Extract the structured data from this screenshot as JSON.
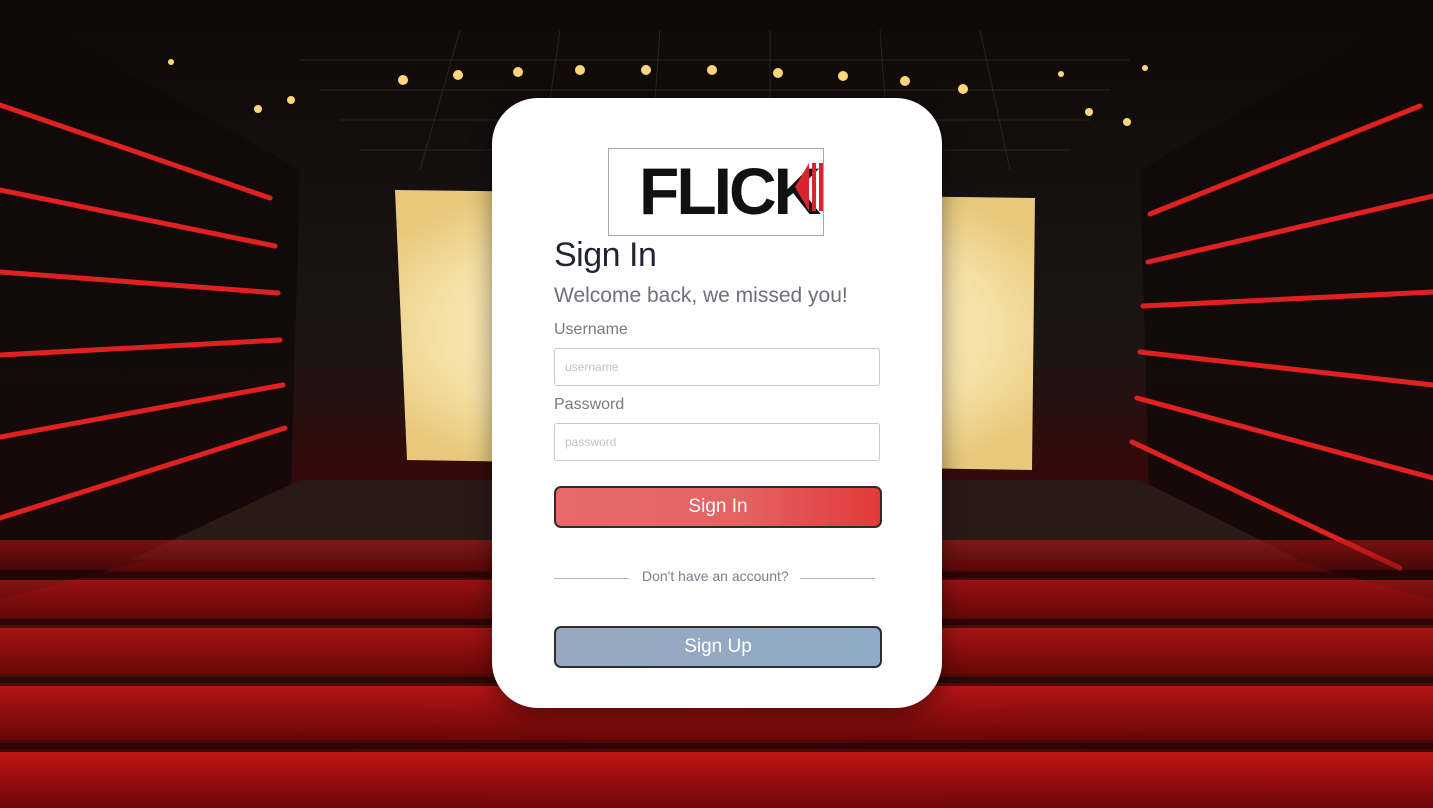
{
  "logo": {
    "text": "FLICK",
    "accent_color": "#d7262b"
  },
  "login": {
    "title": "Sign In",
    "subtitle": "Welcome back, we missed you!",
    "username_label": "Username",
    "username_placeholder": "username",
    "username_value": "",
    "password_label": "Password",
    "password_placeholder": "password",
    "password_value": "",
    "signin_button": "Sign In",
    "divider_text": "Don't have an account?",
    "signup_button": "Sign Up"
  },
  "colors": {
    "signin_gradient": [
      "#e66a6a",
      "#e23a3a"
    ],
    "signup_gradient": [
      "#99a8bf",
      "#8fabc7"
    ],
    "title": "#1f2533"
  }
}
